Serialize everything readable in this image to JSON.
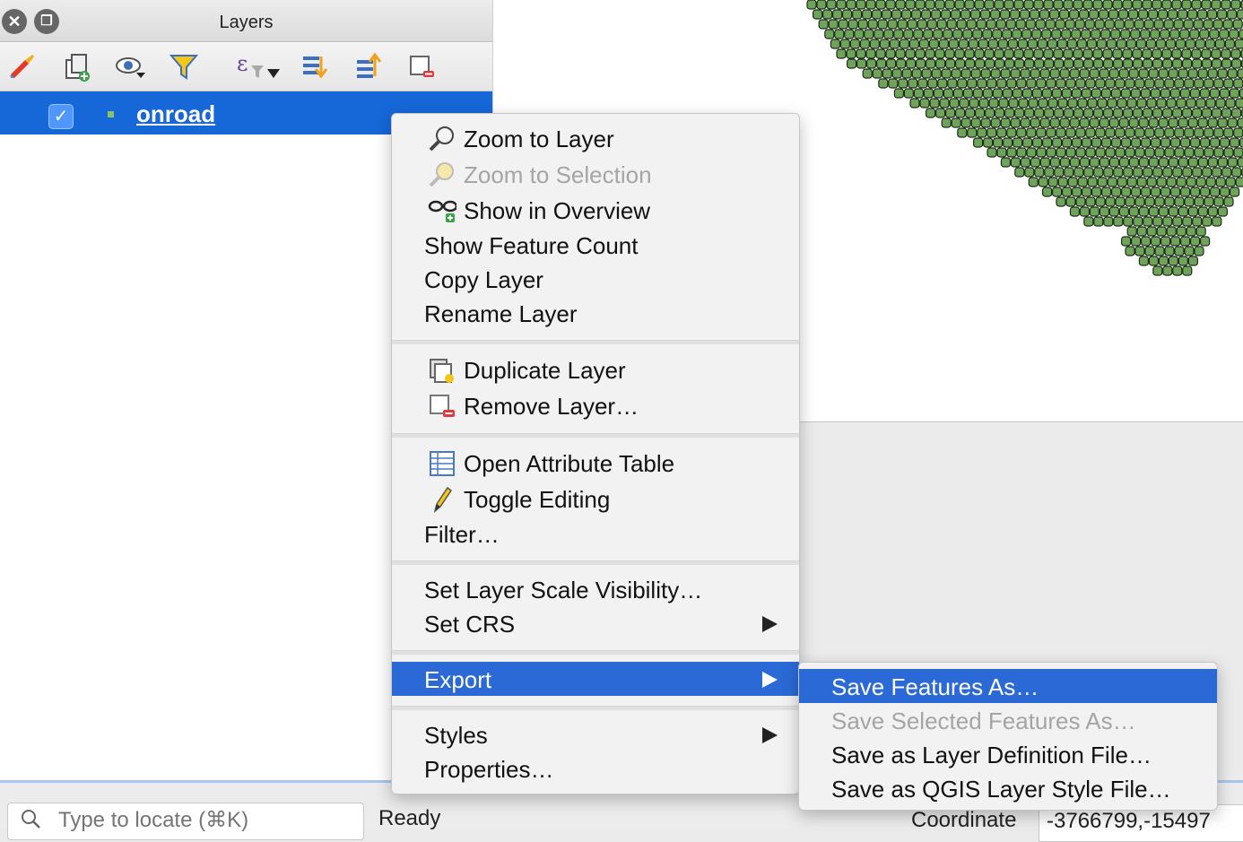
{
  "panel": {
    "title": "Layers",
    "toolbar_icons": [
      "style-manager-icon",
      "add-group-icon",
      "visibility-icon",
      "filter-legend-icon",
      "filter-expression-icon",
      "expand-all-icon",
      "collapse-all-icon",
      "remove-layer-icon"
    ]
  },
  "layer": {
    "name": "onroad",
    "checked": true
  },
  "context_menu": {
    "zoom_to_layer": "Zoom to Layer",
    "zoom_to_selection": "Zoom to Selection",
    "show_in_overview": "Show in Overview",
    "show_feature_count": "Show Feature Count",
    "copy_layer": "Copy Layer",
    "rename_layer": "Rename Layer",
    "duplicate_layer": "Duplicate Layer",
    "remove_layer": "Remove Layer…",
    "open_attribute_table": "Open Attribute Table",
    "toggle_editing": "Toggle Editing",
    "filter": "Filter…",
    "set_scale_visibility": "Set Layer Scale Visibility…",
    "set_crs": "Set CRS",
    "export": "Export",
    "styles": "Styles",
    "properties": "Properties…"
  },
  "export_submenu": {
    "save_features_as": "Save Features As…",
    "save_selected_features_as": "Save Selected Features As…",
    "save_layer_definition": "Save as Layer Definition File…",
    "save_qgis_style": "Save as QGIS Layer Style File…"
  },
  "status": {
    "locator_placeholder": "Type to locate (⌘K)",
    "message": "Ready",
    "coordinate_label": "Coordinate",
    "coordinate_value": "-3766799,-15497"
  },
  "colors": {
    "selection_blue": "#1667d8",
    "menu_highlight": "#2a69d6",
    "feature_fill": "#6ea35a",
    "feature_stroke": "#1f2a1a"
  }
}
